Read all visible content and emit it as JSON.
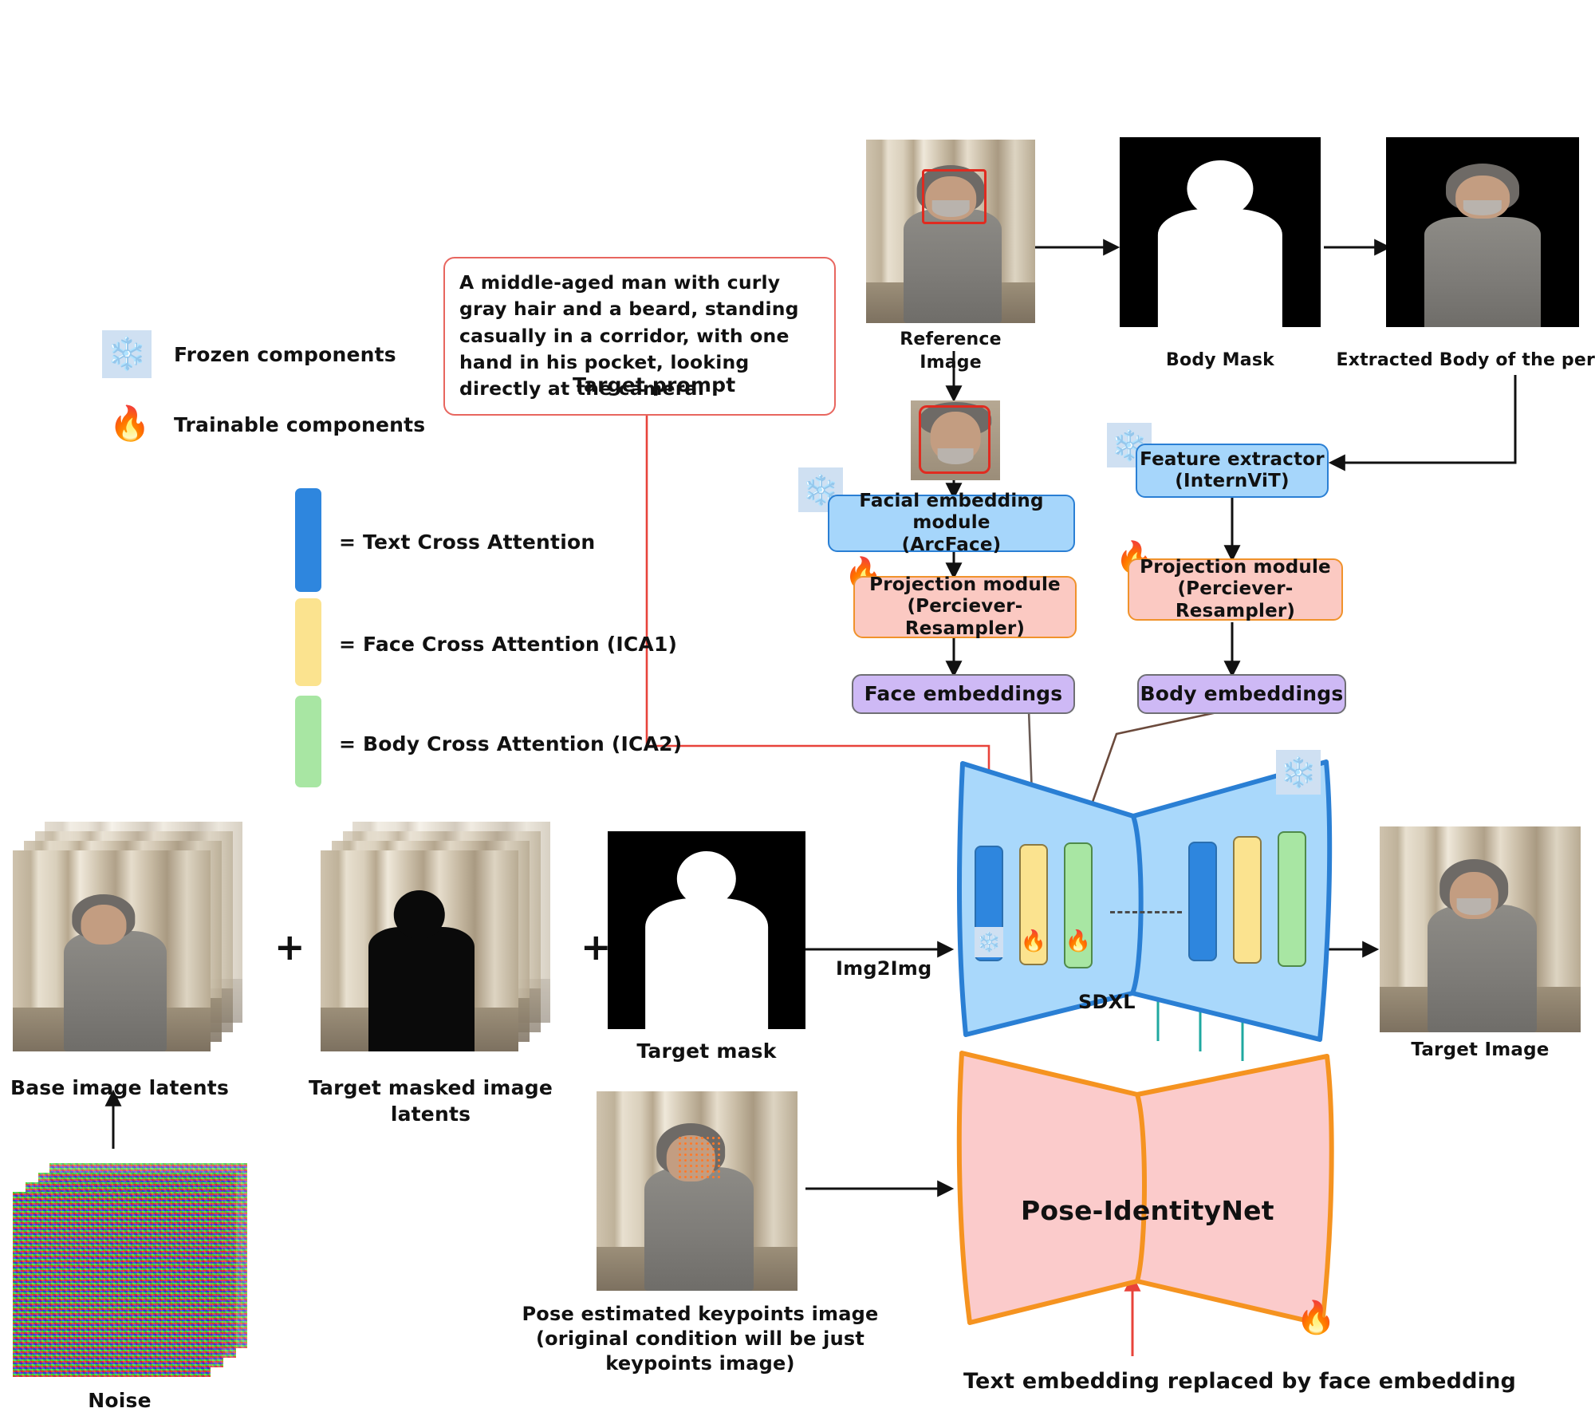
{
  "legend": {
    "frozen": {
      "icon": "snowflake-icon",
      "label": "Frozen components"
    },
    "trainable": {
      "icon": "fire-icon",
      "label": "Trainable components"
    },
    "attention": [
      {
        "color": "#2e86de",
        "label": "= Text Cross Attention"
      },
      {
        "color": "#fbe38f",
        "label": "= Face Cross Attention (ICA1)"
      },
      {
        "color": "#a8e6a3",
        "label": "= Body Cross Attention (ICA2)"
      }
    ]
  },
  "prompt": {
    "text": "A middle-aged man with curly gray hair and a beard, standing casually in a corridor, with one hand in his pocket, looking directly at the camera.",
    "caption": "Target prompt",
    "border_color": "#e8665f"
  },
  "reference": {
    "image_caption": "Reference Image",
    "body_mask_caption": "Body Mask",
    "extracted_body_caption": "Extracted Body of the person"
  },
  "face_branch": {
    "embedding_module": "Facial embedding module\n(ArcFace)",
    "projection_module": "Projection module\n(Perciever-Resampler)",
    "embeddings": "Face embeddings"
  },
  "body_branch": {
    "feature_extractor": "Feature extractor\n(InternViT)",
    "projection_module": "Projection module\n(Perciever-Resampler)",
    "embeddings": "Body embeddings"
  },
  "inputs": {
    "base_latents": "Base image latents",
    "target_masked_latents": "Target masked image\nlatents",
    "target_mask": "Target mask",
    "noise": "Noise",
    "plus_1": "+",
    "plus_2": "+"
  },
  "pipeline": {
    "img2img_label": "Img2Img",
    "unet_label": "SDXL",
    "controlnet_label": "Pose-IdentityNet",
    "pose_caption": "Pose estimated keypoints image\n(original condition will be just keypoints image)",
    "bottom_note": "Text embedding replaced by face embedding",
    "output_caption": "Target Image"
  },
  "colors": {
    "unet_fill": "#a9d8fb",
    "unet_stroke": "#2a7fd4",
    "controlnet_fill": "#fbcbcb",
    "controlnet_stroke": "#f59320",
    "text_attn": "#2e86de",
    "face_attn": "#fbe38f",
    "body_attn": "#a8e6a3",
    "red_link": "#e8433a",
    "brown_link": "#6b4a3c",
    "teal_arrow": "#1fa8a0"
  }
}
